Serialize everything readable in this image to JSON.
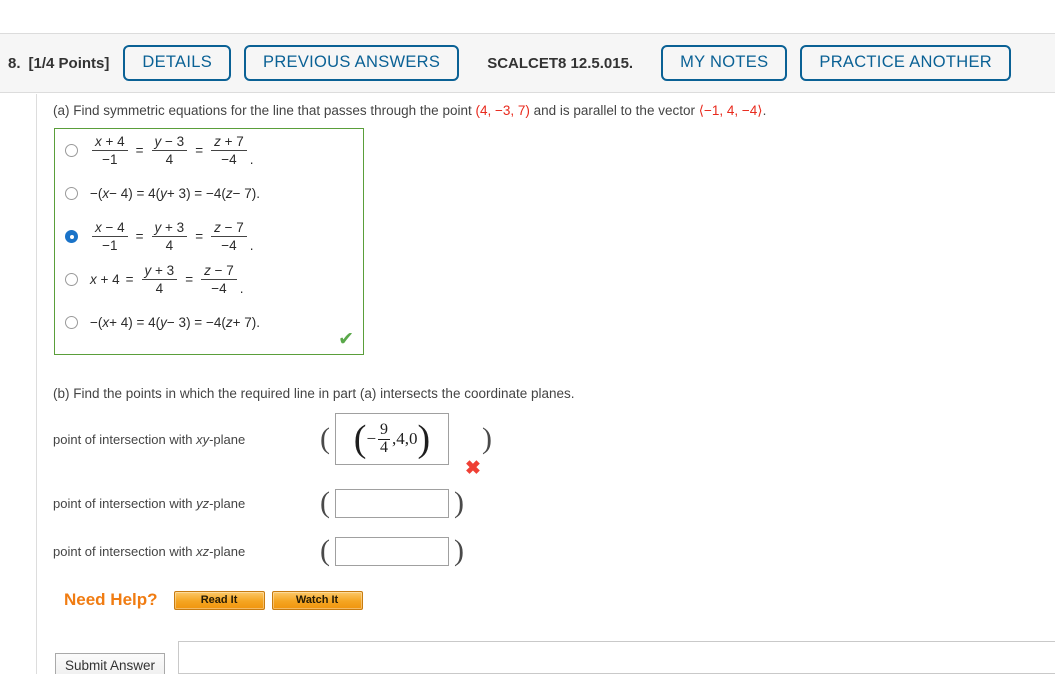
{
  "header": {
    "question_number": "8.",
    "points": "[1/4 Points]",
    "details_label": "DETAILS",
    "previous_answers_label": "PREVIOUS ANSWERS",
    "textbook_code": "SCALCET8 12.5.015.",
    "my_notes_label": "MY NOTES",
    "practice_another_label": "PRACTICE ANOTHER",
    "accent_color": "#0a6195",
    "bar_background": "#f6f6f6"
  },
  "part_a": {
    "prompt_pre": "(a) Find symmetric equations for the line that passes through the point ",
    "point": "(4, −3, 7)",
    "prompt_mid": " and is parallel to the vector ",
    "vector": "⟨−1, 4, −4⟩",
    "prompt_end": ".",
    "highlight_color": "#e8291c",
    "box_border_color": "#5a9e3a",
    "selected_index": 2,
    "correct_mark": "✔",
    "options": [
      {
        "kind": "fraction",
        "terms": [
          {
            "num": "x + 4",
            "den": "−1"
          },
          {
            "num": "y − 3",
            "den": "4"
          },
          {
            "num": "z + 7",
            "den": "−4"
          }
        ],
        "trailing": ".",
        "selected": false
      },
      {
        "kind": "plain",
        "text": "−(x − 4) = 4(y + 3) = −4(z − 7).",
        "selected": false
      },
      {
        "kind": "fraction",
        "terms": [
          {
            "num": "x − 4",
            "den": "−1"
          },
          {
            "num": "y + 3",
            "den": "4"
          },
          {
            "num": "z − 7",
            "den": "−4"
          }
        ],
        "trailing": ".",
        "selected": true
      },
      {
        "kind": "mixed",
        "lead": "x + 4",
        "terms": [
          {
            "num": "y + 3",
            "den": "4"
          },
          {
            "num": "z − 7",
            "den": "−4"
          }
        ],
        "trailing": ".",
        "selected": false
      },
      {
        "kind": "plain",
        "text": "−(x + 4) = 4(y − 3) = −4(z + 7).",
        "selected": false
      }
    ]
  },
  "part_b": {
    "prompt": "(b) Find the points in which the required line in part (a) intersects the coordinate planes.",
    "rows": [
      {
        "label_pre": "point of intersection with ",
        "label_plane": "xy",
        "label_post": "-plane",
        "value_prefix": "−",
        "value_numerator": "9",
        "value_denominator": "4",
        "value_rest": ",4,0",
        "filled": true,
        "mark": "✖",
        "mark_color": "#ef4035"
      },
      {
        "label_pre": "point of intersection with ",
        "label_plane": "yz",
        "label_post": "-plane",
        "value": "",
        "filled": false
      },
      {
        "label_pre": "point of intersection with ",
        "label_plane": "xz",
        "label_post": "-plane",
        "value": "",
        "filled": false
      }
    ],
    "open_paren": "(",
    "close_paren": ")"
  },
  "need_help": {
    "label": "Need Help?",
    "label_color": "#f07c12",
    "read_it_label": "Read It",
    "watch_it_label": "Watch It"
  },
  "footer": {
    "submit_label": "Submit Answer"
  }
}
